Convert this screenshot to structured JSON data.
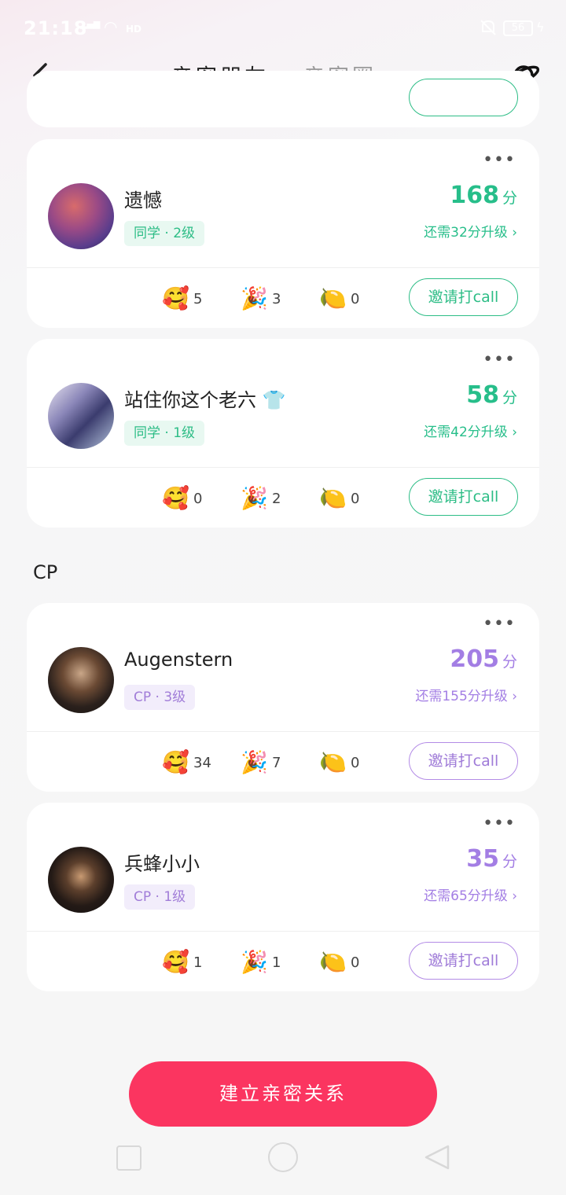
{
  "status_bar": {
    "time": "21:18",
    "signal": "4G\n.ıll",
    "hd": "HD",
    "battery": "56"
  },
  "header": {
    "tabs": [
      "亲密朋友",
      "亲密圈"
    ],
    "active_tab": 0
  },
  "icons": {
    "back": "chevron-left-icon",
    "planet": "planet-icon",
    "more": "more-dots-icon",
    "heart_face": "heart-hug-emoji",
    "party": "party-popper-emoji",
    "lemon": "lemon-face-emoji"
  },
  "friends": [
    {
      "name": "遗憾",
      "tag": "同学 · 2级",
      "score": "168",
      "score_unit": "分",
      "need": "还需32分升级 ›",
      "reactions": [
        "5",
        "3",
        "0"
      ],
      "call": "邀请打call"
    },
    {
      "name": "站住你这个老六 👕",
      "tag": "同学 · 1级",
      "score": "58",
      "score_unit": "分",
      "need": "还需42分升级 ›",
      "reactions": [
        "0",
        "2",
        "0"
      ],
      "call": "邀请打call"
    }
  ],
  "cp_section_title": "CP",
  "cp": [
    {
      "name": "Augenstern",
      "tag": "CP · 3级",
      "score": "205",
      "score_unit": "分",
      "need": "还需155分升级 ›",
      "reactions": [
        "34",
        "7",
        "0"
      ],
      "call": "邀请打call"
    },
    {
      "name": "兵蜂小小",
      "tag": "CP · 1级",
      "score": "35",
      "score_unit": "分",
      "need": "还需65分升级 ›",
      "reactions": [
        "1",
        "1",
        "0"
      ],
      "call": "邀请打call"
    }
  ],
  "emoji": {
    "heart": "🥰",
    "party": "🎉",
    "lemon": "🍋"
  },
  "cta": "建立亲密关系",
  "colors": {
    "friend_accent": "#27be8a",
    "cp_accent": "#a37ee4",
    "cta": "#fb3560"
  }
}
